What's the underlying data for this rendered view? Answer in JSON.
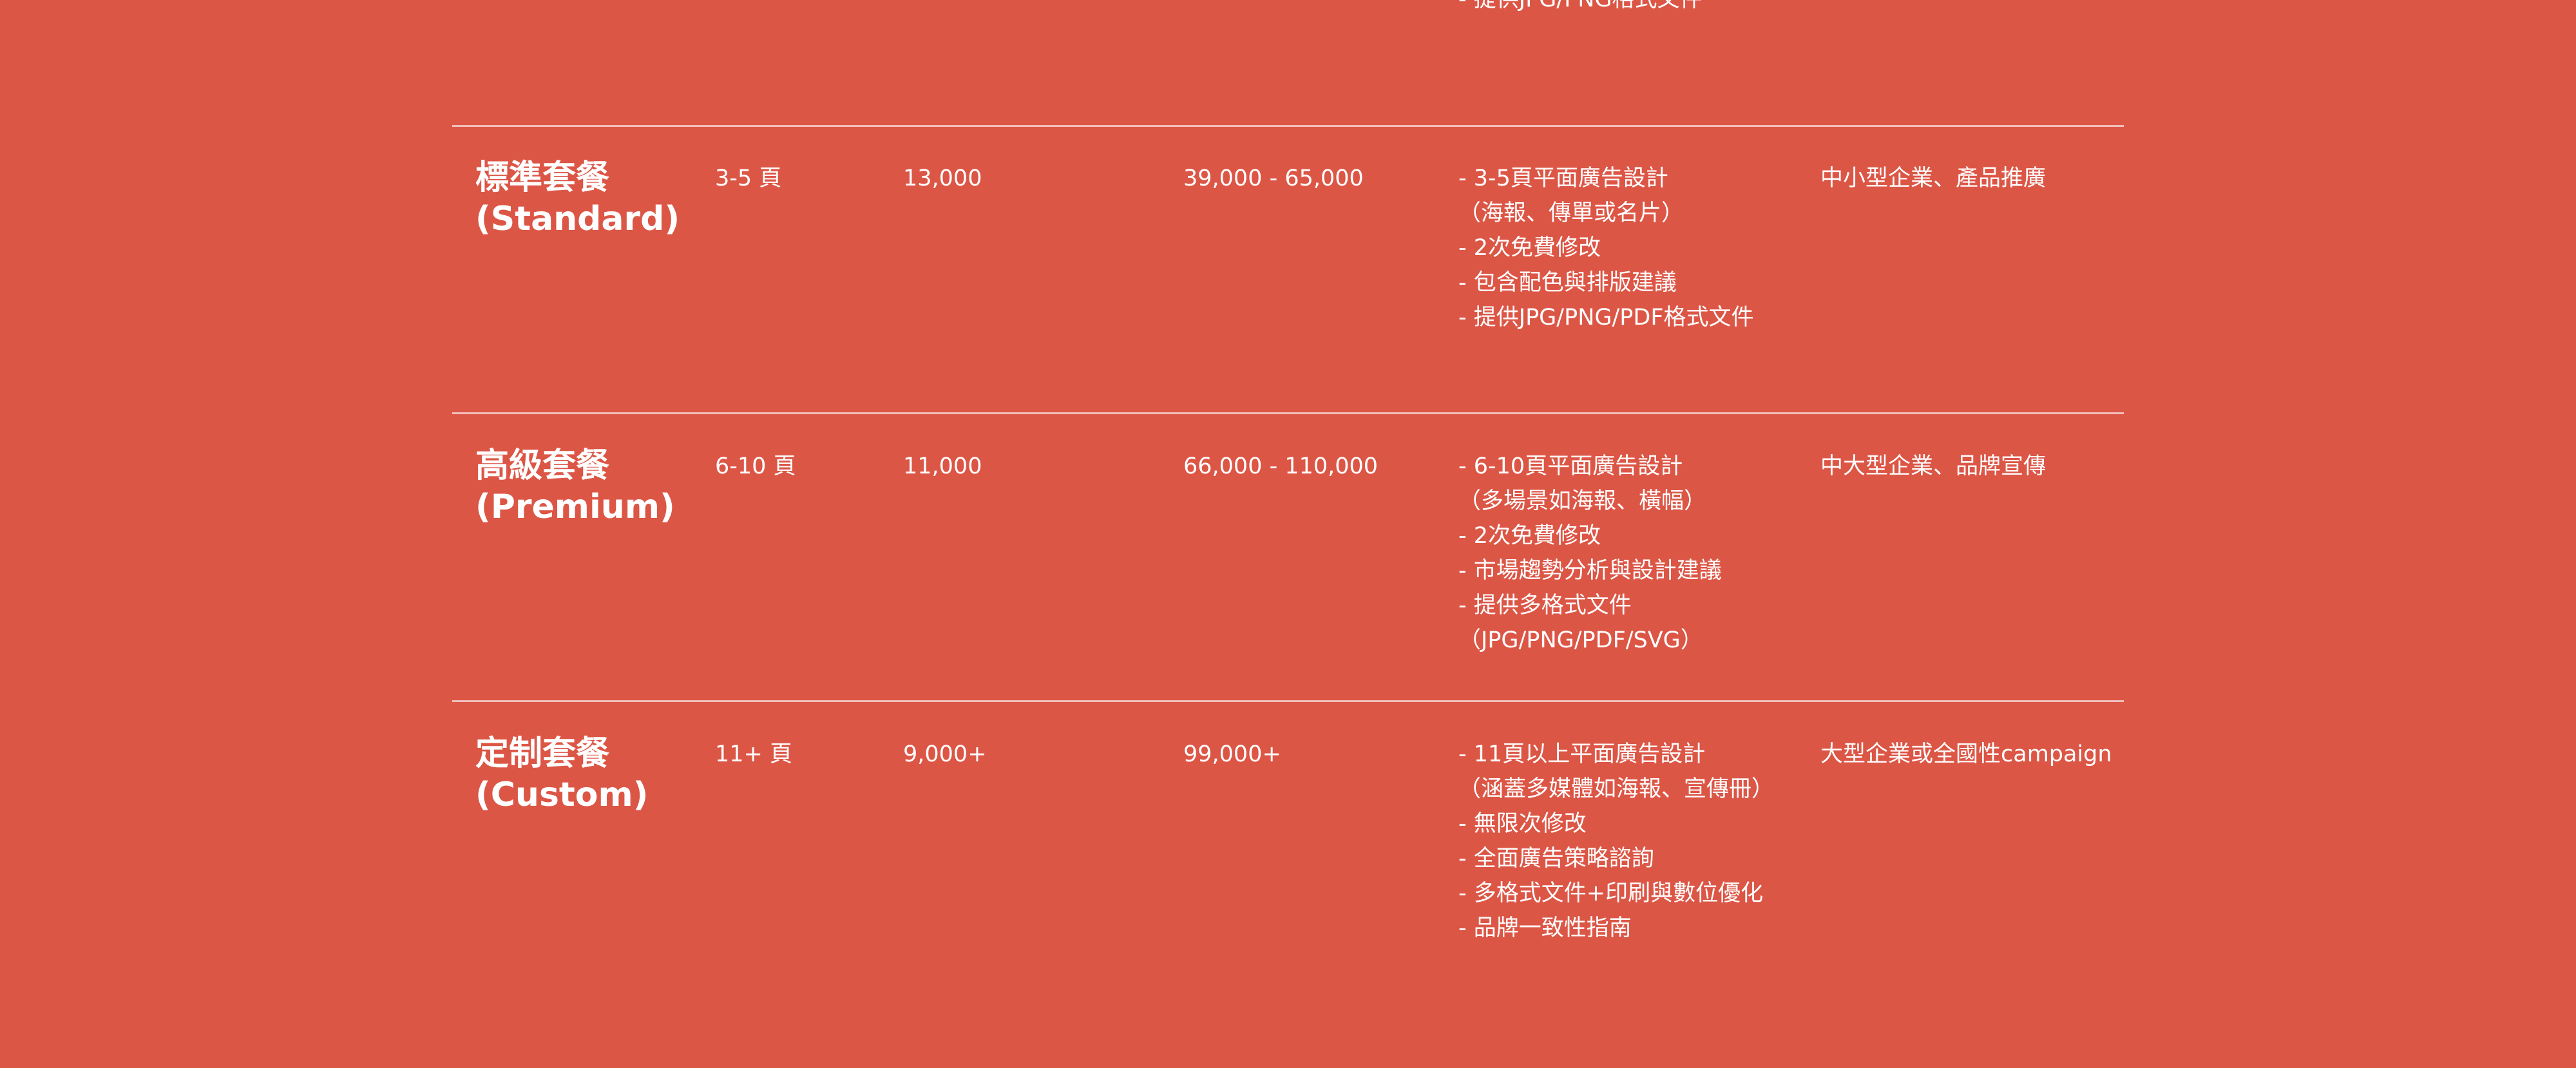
{
  "top_fragment": "- 提供JPG/PNG格式文件",
  "packages": [
    {
      "name": "標準套餐",
      "name_en": "(Standard)",
      "pages": "3-5 頁",
      "unit_price": "13,000",
      "total": "39,000 - 65,000",
      "content": [
        "- 3-5頁平面廣告設計",
        "（海報、傳單或名片）",
        "- 2次免費修改",
        "- 包含配色與排版建議",
        "- 提供JPG/PNG/PDF格式文件"
      ],
      "target": "中小型企業、產品推廣"
    },
    {
      "name": "高級套餐",
      "name_en": "(Premium)",
      "pages": "6-10 頁",
      "unit_price": "11,000",
      "total": "66,000 - 110,000",
      "content": [
        "- 6-10頁平面廣告設計",
        "（多場景如海報、橫幅）",
        "- 2次免費修改",
        "- 市場趨勢分析與設計建議",
        "- 提供多格式文件",
        "（JPG/PNG/PDF/SVG）"
      ],
      "target": "中大型企業、品牌宣傳"
    },
    {
      "name": "定制套餐",
      "name_en": "(Custom)",
      "pages": "11+ 頁",
      "unit_price": "9,000+",
      "total": "99,000+",
      "content": [
        "- 11頁以上平面廣告設計",
        "（涵蓋多媒體如海報、宣傳冊）",
        "- 無限次修改",
        "- 全面廣告策略諮詢",
        "- 多格式文件+印刷與數位優化",
        "- 品牌一致性指南"
      ],
      "target": "大型企業或全國性campaign"
    }
  ],
  "colors": {
    "background": "#dc5646",
    "text": "#ffffff"
  }
}
